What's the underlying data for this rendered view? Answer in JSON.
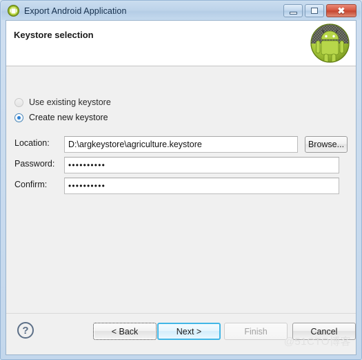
{
  "window": {
    "title": "Export Android Application",
    "title_icon": "android-app-icon",
    "controls": {
      "minimize": "minimize-icon",
      "maximize": "restore-icon",
      "close": "close-icon"
    }
  },
  "header": {
    "title": "Keystore selection",
    "logo": "android-robot-logo"
  },
  "form": {
    "options": [
      {
        "label": "Use existing keystore",
        "checked": false
      },
      {
        "label": "Create new keystore",
        "checked": true
      }
    ],
    "fields": [
      {
        "label": "Location:",
        "value": "D:\\argkeystore\\agriculture.keystore",
        "type": "text"
      },
      {
        "label": "Password:",
        "value": "••••••••••",
        "type": "password"
      },
      {
        "label": "Confirm:",
        "value": "••••••••••",
        "type": "password"
      }
    ],
    "browse_label": "Browse..."
  },
  "footer": {
    "help_icon": "?",
    "buttons": [
      {
        "label": "< Back",
        "state": "focused"
      },
      {
        "label": "Next >",
        "state": "default"
      },
      {
        "label": "Finish",
        "state": "disabled"
      },
      {
        "label": "Cancel",
        "state": "normal"
      }
    ]
  },
  "watermark": "@51CTO博客",
  "colors": {
    "titlebar": "#bed4ea",
    "accent_blue": "#41b6e6",
    "radio_dot": "#2b7fd4",
    "close_red": "#d4553f",
    "body_bg": "#f0f0f0",
    "android_green": "#a4c639"
  }
}
